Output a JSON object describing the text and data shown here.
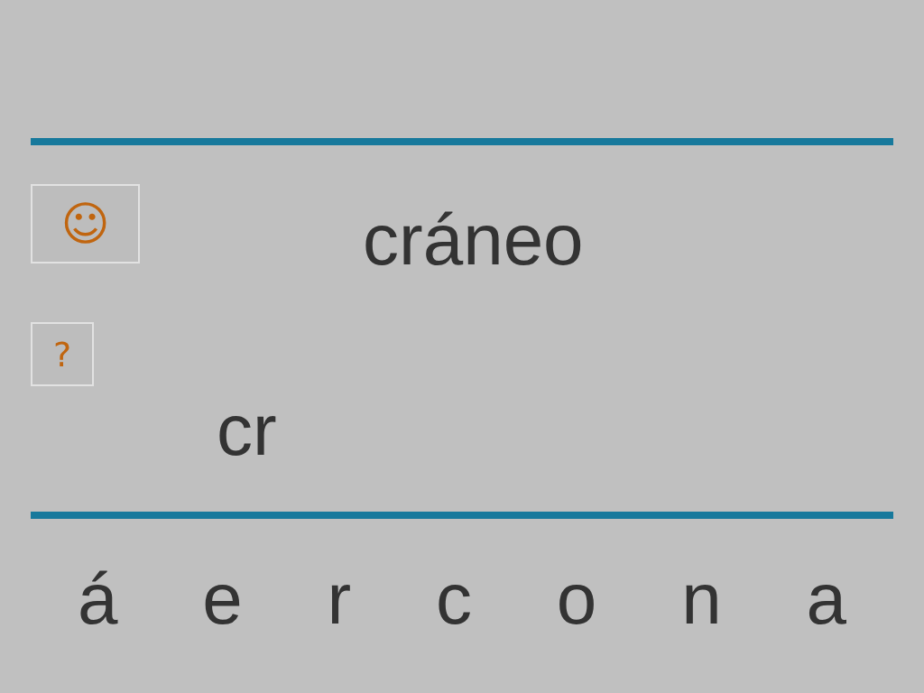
{
  "feedback_button": {
    "symbol": "☺"
  },
  "word": "cráneo",
  "hint_button": {
    "symbol": "?"
  },
  "answer": "cr",
  "letters": [
    "á",
    "e",
    "r",
    "c",
    "o",
    "n",
    "a"
  ]
}
